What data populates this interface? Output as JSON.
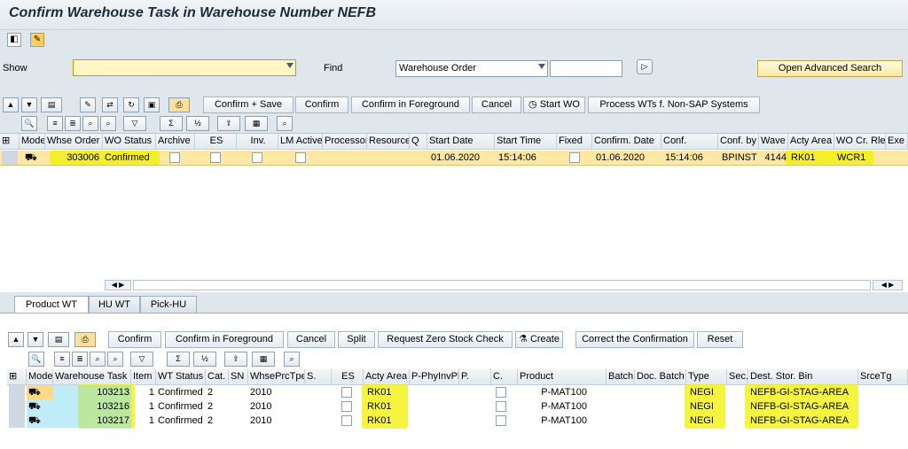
{
  "title": "Confirm Warehouse Task in Warehouse Number NEFB",
  "selection": {
    "show_label": "Show",
    "show_value": "",
    "find_label": "Find",
    "find_value": "Warehouse Order",
    "find_text": "",
    "open_adv_search": "Open Advanced Search"
  },
  "top_toolbar": {
    "confirm_save": "Confirm + Save",
    "confirm": "Confirm",
    "confirm_fg": "Confirm in Foreground",
    "cancel": "Cancel",
    "start_wo": "Start WO",
    "process_wts": "Process WTs f. Non-SAP Systems"
  },
  "wo_table": {
    "headers": [
      "Mode",
      "Whse Order",
      "WO Status",
      "Archive",
      "ES",
      "Inv.",
      "LM Active",
      "Processor",
      "Resource",
      "Q",
      "Start Date",
      "Start Time",
      "Fixed",
      "Confirm. Date",
      "Conf.",
      "Conf. by",
      "Wave",
      "Acty Area",
      "WO Cr. Rle",
      "Exe"
    ],
    "row": {
      "whse_order": "303006",
      "wo_status": "Confirmed",
      "start_date": "01.06.2020",
      "start_time": "15:14:06",
      "confirm_date": "01.06.2020",
      "conf_time": "15:14:06",
      "conf_by": "BPINST",
      "wave": "4144",
      "acty_area": "RK01",
      "wo_cr_rle": "WCR1"
    }
  },
  "tabs": [
    "Product WT",
    "HU WT",
    "Pick-HU"
  ],
  "wt_toolbar": {
    "confirm": "Confirm",
    "confirm_fg": "Confirm in Foreground",
    "cancel": "Cancel",
    "split": "Split",
    "request_zero": "Request Zero Stock Check",
    "create": "Create",
    "correct": "Correct the Confirmation",
    "reset": "Reset"
  },
  "wt_table": {
    "headers": [
      "Mode",
      "Warehouse Task",
      "Item",
      "WT Status",
      "Cat.",
      "SN",
      "WhsePrcTpe",
      "S.",
      "ES",
      "Acty Area",
      "P-PhyInvPl",
      "P.",
      "C.",
      "Product",
      "Batch",
      "Doc. Batch",
      "Type",
      "Sec.",
      "Dest. Stor. Bin",
      "SrceTg"
    ],
    "rows": [
      {
        "task": "103213",
        "item": "1",
        "status": "Confirmed",
        "cat": "2",
        "prc": "2010",
        "area": "RK01",
        "product": "P-MAT100",
        "type": "NEGI",
        "bin": "NEFB-GI-STAG-AREA"
      },
      {
        "task": "103216",
        "item": "1",
        "status": "Confirmed",
        "cat": "2",
        "prc": "2010",
        "area": "RK01",
        "product": "P-MAT100",
        "type": "NEGI",
        "bin": "NEFB-GI-STAG-AREA"
      },
      {
        "task": "103217",
        "item": "1",
        "status": "Confirmed",
        "cat": "2",
        "prc": "2010",
        "area": "RK01",
        "product": "P-MAT100",
        "type": "NEGI",
        "bin": "NEFB-GI-STAG-AREA"
      }
    ]
  }
}
